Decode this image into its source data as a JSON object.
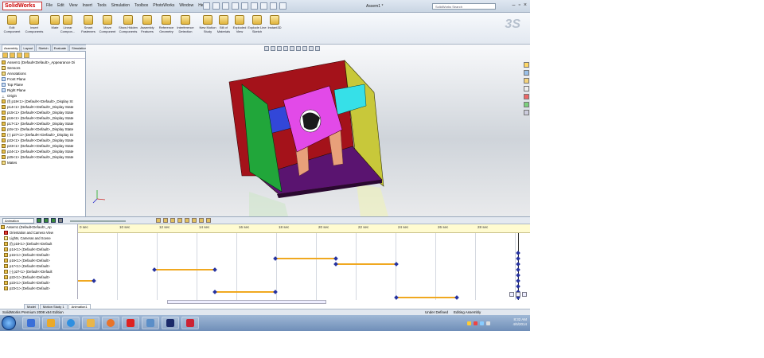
{
  "window": {
    "app_logo": "SolidWorks",
    "menu": [
      "File",
      "Edit",
      "View",
      "Insert",
      "Tools",
      "Simulation",
      "Toolbox",
      "PhotoWorks",
      "Window",
      "Help"
    ],
    "doc_title": "Assem1 *",
    "search_placeholder": "SolidWorks Search"
  },
  "ribbon": {
    "items": [
      {
        "label": "Edit Component"
      },
      {
        "label": "Insert Components"
      },
      {
        "label": "Mate"
      },
      {
        "label": "Linear Compon..."
      },
      {
        "label": "Smart Fasteners"
      },
      {
        "label": "Move Component"
      },
      {
        "label": "Show Hidden Components"
      },
      {
        "label": "Assembly Features"
      },
      {
        "label": "Reference Geometry"
      },
      {
        "label": "Interference Detection"
      },
      {
        "label": "New Motion Study"
      },
      {
        "label": "Bill of Materials"
      },
      {
        "label": "Exploded View"
      },
      {
        "label": "Explode Line Sketch"
      },
      {
        "label": "Instant3D"
      }
    ]
  },
  "panel": {
    "tabs": [
      "Assembly",
      "Layout",
      "Sketch",
      "Evaluate",
      "Simulation"
    ],
    "active_tab": "Assembly",
    "tree": [
      {
        "label": "Assem1 (Default<Default>_Appearance Di",
        "icon": "assembly"
      },
      {
        "label": "Sensors",
        "icon": "folder"
      },
      {
        "label": "Annotations",
        "icon": "folder"
      },
      {
        "label": "Front Plane",
        "icon": "plane"
      },
      {
        "label": "Top Plane",
        "icon": "plane"
      },
      {
        "label": "Right Plane",
        "icon": "plane"
      },
      {
        "label": "Origin",
        "icon": "origin"
      },
      {
        "label": "(f) p18<1> (Default<<Default>_Display St",
        "icon": "part"
      },
      {
        "label": "p14<1> (Default<<Default>_Display State",
        "icon": "part"
      },
      {
        "label": "p15<1> (Default<<Default>_Display State",
        "icon": "part"
      },
      {
        "label": "p16<1> (Default<<Default>_Display State",
        "icon": "part"
      },
      {
        "label": "p17<1> (Default<<Default>_Display State",
        "icon": "part"
      },
      {
        "label": "p2s<1> (Default<<Default>_Display State",
        "icon": "part"
      },
      {
        "label": "(-) p27<1> (Default<<Default>_Display St",
        "icon": "part"
      },
      {
        "label": "p22<1> (Default<<Default>_Display State",
        "icon": "part"
      },
      {
        "label": "p23<1> (Default<<Default>_Display State",
        "icon": "part"
      },
      {
        "label": "p24<1> (Default<<Default>_Display State",
        "icon": "part"
      },
      {
        "label": "p25<1> (Default<<Default>_Display State",
        "icon": "part"
      },
      {
        "label": "Mates",
        "icon": "folder"
      }
    ]
  },
  "motion": {
    "study_type": "Animation",
    "ticks": [
      "0 sec",
      "10 sec",
      "12 sec",
      "14 sec",
      "16 sec",
      "18 sec",
      "20 sec",
      "22 sec",
      "24 sec",
      "26 sec",
      "28 sec"
    ],
    "tree": [
      {
        "label": "Assem1 (Default<Default>_Ap",
        "icon": "assembly"
      },
      {
        "label": "Orientation and Camera View",
        "icon": "red"
      },
      {
        "label": "Lights, Cameras and Scene",
        "icon": "lamp"
      },
      {
        "label": "(f) p18<1> (Default<<Default",
        "icon": "part"
      },
      {
        "label": "p14<1> (Default<<Default>",
        "icon": "part"
      },
      {
        "label": "p15<1> (Default<<Default>",
        "icon": "part"
      },
      {
        "label": "p16<1> (Default<<Default>",
        "icon": "part"
      },
      {
        "label": "p17<1> (Default<<Default>",
        "icon": "part"
      },
      {
        "label": "(-) p27<1> (Default<<Default",
        "icon": "part"
      },
      {
        "label": "p22<1> (Default<<Default>",
        "icon": "part"
      },
      {
        "label": "p23<1> (Default<<Default>",
        "icon": "part"
      },
      {
        "label": "p23<1> (Default<<Default>",
        "icon": "part"
      }
    ],
    "bottom_tabs": [
      "Model",
      "Motion Study 1",
      "Animation1"
    ],
    "active_bottom_tab": "Animation1"
  },
  "status": {
    "edition": "SolidWorks Premium 2008 x64 Edition",
    "state": "Under Defined",
    "mode": "Editing Assembly"
  },
  "taskbar": {
    "time": "8:32 AM",
    "date": "4/5/2014"
  }
}
